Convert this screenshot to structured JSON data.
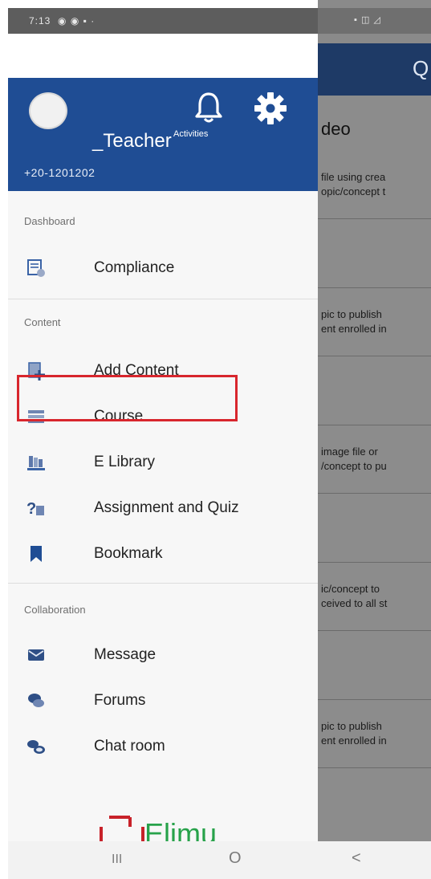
{
  "status_bar": {
    "time": "7:13"
  },
  "drawer": {
    "header": {
      "user_name": "_Teacher",
      "phone": "+20-1201202",
      "activities_label": "Activities"
    },
    "sections": [
      {
        "title": "Dashboard",
        "items": [
          {
            "label": "Compliance",
            "icon": "compliance-icon"
          }
        ]
      },
      {
        "title": "Content",
        "items": [
          {
            "label": "Add Content",
            "icon": "add-content-icon"
          },
          {
            "label": "Course",
            "icon": "course-icon"
          },
          {
            "label": "E Library",
            "icon": "library-icon"
          },
          {
            "label": "Assignment and Quiz",
            "icon": "assignment-icon"
          },
          {
            "label": "Bookmark",
            "icon": "bookmark-icon"
          }
        ]
      },
      {
        "title": "Collaboration",
        "items": [
          {
            "label": "Message",
            "icon": "message-icon"
          },
          {
            "label": "Forums",
            "icon": "forums-icon"
          },
          {
            "label": "Chat room",
            "icon": "chat-icon"
          }
        ]
      }
    ],
    "logo_text": "Elimu"
  },
  "background_app": {
    "title_fragment": "deo",
    "lines": [
      "file using crea",
      "opic/concept t",
      "pic to publish",
      "ent enrolled in",
      "image file or",
      "/concept to pu",
      "ic/concept to",
      "ceived to all st",
      "pic to publish",
      "ent enrolled in"
    ]
  },
  "nav_bar": {
    "recents": "III",
    "home": "O",
    "back": "<"
  },
  "colors": {
    "header": "#1f4d94",
    "highlight": "#d8262d",
    "logo_green": "#27a24a",
    "logo_red": "#c8222a"
  }
}
